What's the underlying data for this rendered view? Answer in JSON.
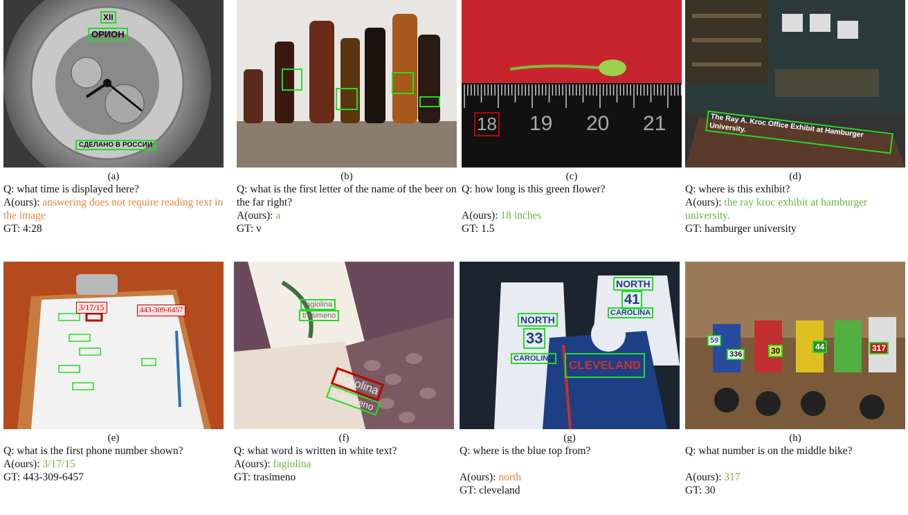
{
  "panels": [
    {
      "label": "(a)",
      "q": "Q: what time is displayed here?",
      "a_prefix": "A(ours): ",
      "a": "answering does not require reading text in the image",
      "a_color": "#e8823a",
      "gt": "GT: 4:28",
      "texts": [
        "ОРИОН",
        "СДЕЛАНО В РОССИИ",
        "XII"
      ]
    },
    {
      "label": "(b)",
      "q": "Q: what is the first letter of the name of the beer on the far right?",
      "a_prefix": "A(ours): ",
      "a": "a",
      "a_color": "#e8823a",
      "gt": "GT: v"
    },
    {
      "label": "(c)",
      "q": "Q: how long is this green flower?",
      "a_prefix": "A(ours): ",
      "a": "18 inches",
      "a_color": "#6bb344",
      "gt": "GT: 1.5",
      "texts": [
        "18",
        "19",
        "20",
        "21"
      ]
    },
    {
      "label": "(d)",
      "q": "Q: where is this exhibit?",
      "a_prefix": "A(ours): ",
      "a": "the ray kroc exhibit at hamburger university.",
      "a_color": "#6bb344",
      "gt": "GT: hamburger university",
      "texts": [
        "The Ray A. Kroc Office Exhibit at Hamburger University."
      ]
    },
    {
      "label": "(e)",
      "q": "Q: what is the first phone number shown?",
      "a_prefix": "A(ours): ",
      "a": "3/17/15",
      "a_color": "#6bb344",
      "gt": "GT: 443-309-6457",
      "texts": [
        "3/17/15",
        "443-309-6457"
      ]
    },
    {
      "label": "(f)",
      "q": "Q: what word is written in white text?",
      "a_prefix": "A(ours): ",
      "a": "fagiolina",
      "a_color": "#6bb344",
      "gt": "GT: trasimeno",
      "texts": [
        "fagiolina",
        "trasimeno"
      ]
    },
    {
      "label": "(g)",
      "q": "Q: where is the blue top from?",
      "a_prefix": "A(ours): ",
      "a": "north",
      "a_color": "#e8823a",
      "gt": "GT: cleveland",
      "texts": [
        "NORTH",
        "33",
        "CAROLINA",
        "NORTH",
        "41",
        "CAROLINA",
        "CLEVELAND"
      ]
    },
    {
      "label": "(h)",
      "q": "Q: what number is on the middle bike?",
      "a_prefix": "A(ours): ",
      "a": "317",
      "a_color": "#6bb344",
      "gt": "GT: 30",
      "texts": [
        "59",
        "336",
        "30",
        "44",
        "317"
      ]
    }
  ],
  "colors": {
    "orange": "#e8823a",
    "green": "#6bb344",
    "box_green": "#22dd22",
    "box_red": "#c00000"
  }
}
